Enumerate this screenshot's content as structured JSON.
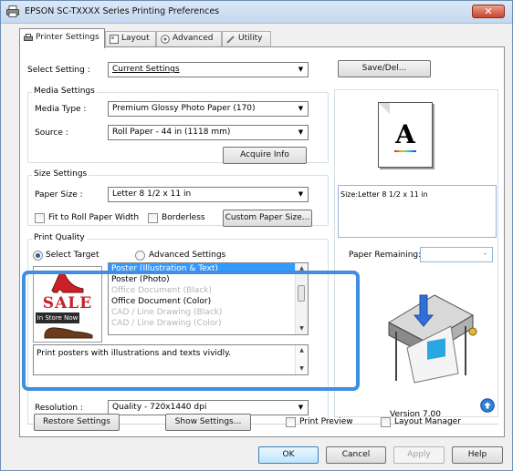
{
  "window": {
    "title": "EPSON SC-TXXXX Series Printing Preferences",
    "close_glyph": "✕"
  },
  "tabs": [
    {
      "label": "Printer Settings",
      "icon": "printer-icon"
    },
    {
      "label": "Layout",
      "icon": "layout-icon"
    },
    {
      "label": "Advanced",
      "icon": "advanced-icon"
    },
    {
      "label": "Utility",
      "icon": "utility-icon"
    }
  ],
  "select_setting": {
    "label": "Select Setting :",
    "value": "Current Settings",
    "button": "Save/Del..."
  },
  "media": {
    "group": "Media Settings",
    "type_label": "Media Type :",
    "type_value": "Premium Glossy Photo Paper (170)",
    "source_label": "Source :",
    "source_value": "Roll Paper - 44 in (1118 mm)",
    "acquire_button": "Acquire Info"
  },
  "size": {
    "group": "Size Settings",
    "paper_label": "Paper Size :",
    "paper_value": "Letter 8 1/2 x 11 in",
    "fit_label": "Fit to Roll Paper Width",
    "borderless_label": "Borderless",
    "custom_button": "Custom Paper Size..."
  },
  "quality": {
    "group": "Print Quality",
    "select_target": "Select Target",
    "advanced": "Advanced Settings",
    "targets": [
      {
        "label": "Poster (Illustration & Text)",
        "state": "selected"
      },
      {
        "label": "Poster (Photo)",
        "state": "normal"
      },
      {
        "label": "Office Document (Black)",
        "state": "disabled"
      },
      {
        "label": "Office Document (Color)",
        "state": "normal"
      },
      {
        "label": "CAD / Line Drawing (Black)",
        "state": "disabled"
      },
      {
        "label": "CAD / Line Drawing (Color)",
        "state": "disabled"
      }
    ],
    "sale_text": "SALE",
    "store_text": "In Store Now",
    "description": "Print posters with illustrations and texts vividly.",
    "resolution_label": "Resolution :",
    "resolution_value": "Quality - 720x1440 dpi"
  },
  "preview": {
    "letter": "A",
    "size_text": "Size:Letter 8 1/2 x 11 in",
    "paper_remaining_label": "Paper Remaining:",
    "version": "Version 7.00"
  },
  "bottom": {
    "restore": "Restore Settings",
    "show": "Show Settings...",
    "print_preview": "Print Preview",
    "layout_manager": "Layout Manager"
  },
  "footer": {
    "ok": "OK",
    "cancel": "Cancel",
    "apply": "Apply",
    "help": "Help"
  },
  "colors": {
    "accent_highlight": "#3f8fe0",
    "selection": "#3399ff"
  }
}
